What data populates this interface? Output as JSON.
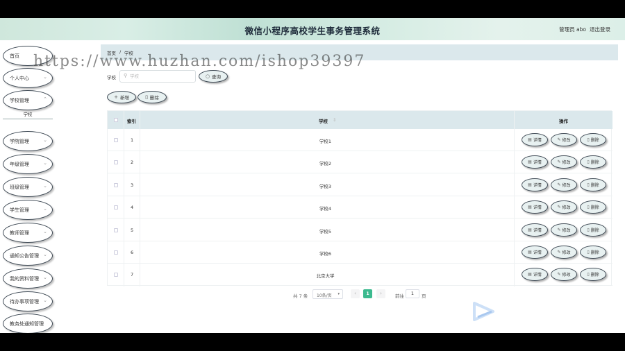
{
  "header": {
    "title": "微信小程序高校学生事务管理系统",
    "user": "管理员 abo",
    "logout": "退出登录"
  },
  "watermark": "https://www.huzhan.com/ishop39397",
  "sidebar": {
    "items": [
      {
        "label": "首页"
      },
      {
        "label": "个人中心"
      },
      {
        "label": "学校管理"
      },
      {
        "label": "学院管理"
      },
      {
        "label": "年级管理"
      },
      {
        "label": "班级管理"
      },
      {
        "label": "学生管理"
      },
      {
        "label": "教师管理"
      },
      {
        "label": "通知公告管理"
      },
      {
        "label": "我的资料管理"
      },
      {
        "label": "待办事项管理"
      },
      {
        "label": "教务处通知管理"
      }
    ],
    "sub_item": "学校",
    "chevron": "chevron-down-icon"
  },
  "breadcrumb": {
    "home": "首页",
    "separator": "/",
    "current": "学校"
  },
  "search": {
    "label": "学校",
    "placeholder": "学校",
    "button": "查询"
  },
  "actions": {
    "add": "新增",
    "delete": "删除"
  },
  "table": {
    "headers": {
      "index": "索引",
      "school": "学校",
      "ops": "操作"
    },
    "rows": [
      {
        "index": "1",
        "school": "学校1"
      },
      {
        "index": "2",
        "school": "学校2"
      },
      {
        "index": "3",
        "school": "学校3"
      },
      {
        "index": "4",
        "school": "学校4"
      },
      {
        "index": "5",
        "school": "学校5"
      },
      {
        "index": "6",
        "school": "学校6"
      },
      {
        "index": "7",
        "school": "北京大学"
      }
    ],
    "row_actions": {
      "detail": "详情",
      "edit": "修改",
      "delete": "删除"
    }
  },
  "pagination": {
    "total": "共 7 条",
    "page_size": "10条/页",
    "current_page": "1",
    "goto_label": "前往",
    "goto_value": "1",
    "page_suffix": "页"
  },
  "colors": {
    "accent": "#3cba8f",
    "header_bg": "#dbe8ec",
    "outline": "#3f4a55"
  }
}
